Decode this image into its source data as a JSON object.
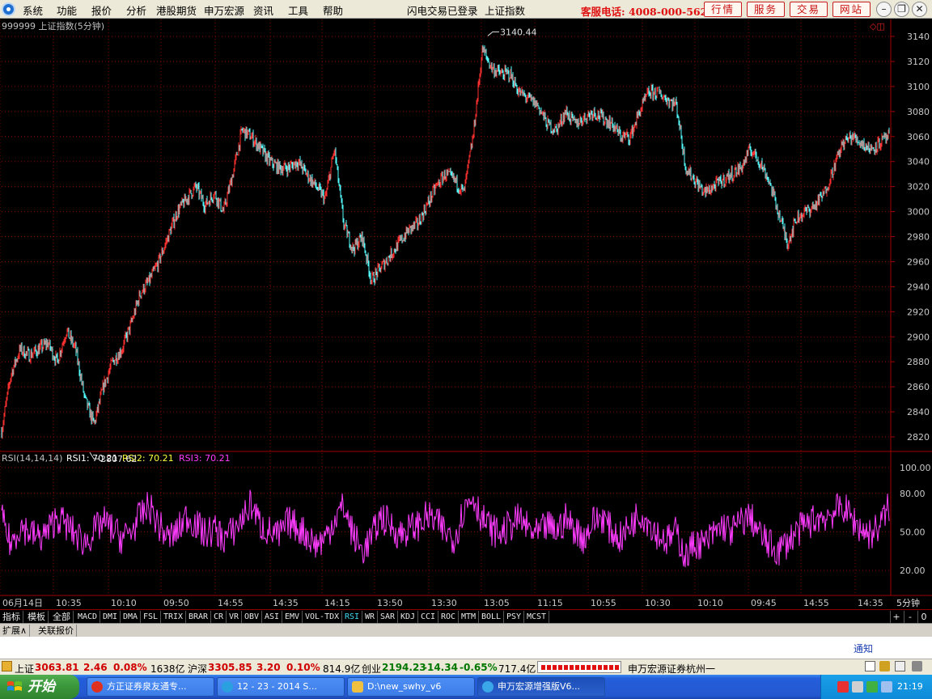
{
  "menubar": {
    "items": [
      "系统",
      "功能",
      "报价",
      "分析",
      "港股期货",
      "申万宏源",
      "资讯",
      "工具",
      "帮助"
    ],
    "status": "闪电交易已登录",
    "index_name": "上证指数",
    "hotline": "客服电话: 4008-000-562",
    "buttons": [
      "行情",
      "服务",
      "交易",
      "网站"
    ]
  },
  "price_panel": {
    "title": "999999 上证指数(5分钟)",
    "high_label": "3140.44",
    "low_label": "2807.62"
  },
  "rsi_panel": {
    "name": "RSI(14,14,14)",
    "rsi1_label": "RSI1: 70.21",
    "rsi2_label": "RSI2: 70.21",
    "rsi3_label": "RSI3: 70.21"
  },
  "chart_data": [
    {
      "type": "line",
      "title": "999999 上证指数(5分钟)",
      "ylim": [
        2800,
        3150
      ],
      "y_ticks": [
        3140,
        3120,
        3100,
        3080,
        3060,
        3040,
        3020,
        3000,
        2980,
        2960,
        2940,
        2920,
        2900,
        2880,
        2860,
        2840,
        2820
      ],
      "x_ticks": [
        "06月14日",
        "10:35",
        "10:10",
        "09:50",
        "14:55",
        "14:35",
        "14:15",
        "13:50",
        "13:30",
        "13:05",
        "11:15",
        "10:55",
        "10:30",
        "10:10",
        "09:45",
        "14:55",
        "14:35"
      ],
      "x_period": "5分钟",
      "series": [
        {
          "values": [
            2825,
            2870,
            2890,
            2885,
            2890,
            2895,
            2880,
            2905,
            2890,
            2850,
            2830,
            2860,
            2880,
            2890,
            2910,
            2935,
            2945,
            2960,
            2980,
            3000,
            3010,
            3020,
            3005,
            3015,
            3000,
            3030,
            3065,
            3060,
            3050,
            3040,
            3035,
            3035,
            3040,
            3030,
            3020,
            3010,
            3050,
            2990,
            2970,
            2980,
            2945,
            2955,
            2965,
            2975,
            2985,
            2990,
            3005,
            3020,
            3030,
            3025,
            3015,
            3060,
            3130,
            3115,
            3110,
            3110,
            3095,
            3090,
            3085,
            3070,
            3065,
            3080,
            3070,
            3075,
            3080,
            3075,
            3070,
            3060,
            3060,
            3080,
            3095,
            3095,
            3090,
            3085,
            3035,
            3025,
            3015,
            3020,
            3025,
            3030,
            3035,
            3050,
            3040,
            3025,
            3000,
            2975,
            2995,
            3000,
            3005,
            3015,
            3035,
            3055,
            3060,
            3055,
            3050,
            3055,
            3060
          ]
        }
      ],
      "annotations": [
        {
          "text": "3140.44",
          "y": 3140.44
        },
        {
          "text": "2807.62",
          "y": 2807.62
        }
      ]
    },
    {
      "type": "line",
      "title": "RSI(14,14,14)",
      "ylim": [
        10,
        100
      ],
      "y_ticks": [
        100,
        80,
        50,
        20
      ],
      "series": [
        {
          "name": "RSI1",
          "values": [
            60,
            40,
            55,
            50,
            45,
            50,
            62,
            55,
            48,
            42,
            50,
            58,
            52,
            45,
            50,
            62,
            70,
            55,
            45,
            50,
            62,
            56,
            48,
            52,
            45,
            50,
            60,
            72,
            55,
            50,
            46,
            58,
            54,
            48,
            40,
            45,
            60,
            70,
            48,
            35,
            45,
            62,
            56,
            48,
            52,
            55,
            62,
            58,
            50,
            45,
            68,
            78,
            60,
            52,
            48,
            55,
            60,
            52,
            47,
            55,
            50,
            60,
            52,
            45,
            58,
            62,
            50,
            45,
            55,
            65,
            58,
            48,
            43,
            50,
            30,
            42,
            40,
            48,
            55,
            50,
            58,
            62,
            48,
            40,
            35,
            42,
            50,
            55,
            60,
            62,
            65,
            70,
            60,
            52,
            48,
            55,
            70
          ]
        }
      ]
    }
  ],
  "tabs": {
    "chinese": [
      "指标",
      "模板",
      "全部"
    ],
    "indicators": [
      "MACD",
      "DMI",
      "DMA",
      "FSL",
      "TRIX",
      "BRAR",
      "CR",
      "VR",
      "OBV",
      "ASI",
      "EMV",
      "VOL-TDX",
      "RSI",
      "WR",
      "SAR",
      "KDJ",
      "CCI",
      "ROC",
      "MTM",
      "BOLL",
      "PSY",
      "MCST"
    ],
    "active": "RSI",
    "controls": [
      "+",
      "-",
      "0"
    ]
  },
  "extension_tabs": [
    "扩展∧",
    "关联报价"
  ],
  "notify": "通知",
  "statusbar": {
    "sh_label": "上证",
    "sh_value": "3063.81",
    "sh_change": "2.46",
    "sh_pct": "0.08%",
    "sh_amount": "1638亿",
    "hs_label": "沪深",
    "hs_value": "3305.85",
    "hs_change": "3.20",
    "hs_pct": "0.10%",
    "hs_amount": "814.9亿",
    "cy_label": "创业",
    "cy_value": "2194.23",
    "cy_change": "-14.34",
    "cy_pct": "-0.65%",
    "cy_amount": "717.4亿",
    "broker": "申万宏源证券杭州一"
  },
  "taskbar": {
    "start": "开始",
    "tasks": [
      "方正证券泉友通专...",
      "12 - 23 - 2014 S...",
      "D:\\new_swhy_v6",
      "申万宏源增强版V6..."
    ],
    "clock": "21:19"
  },
  "colors": {
    "up": "#ff3030",
    "down": "#54ffff",
    "rsi1": "#ff3cff",
    "rsi2": "#ffff3c",
    "grid": "#8a0000",
    "axis_text": "#c8c8c8",
    "title": "#c0c0c0",
    "active_tab": "#3fd8f0"
  }
}
